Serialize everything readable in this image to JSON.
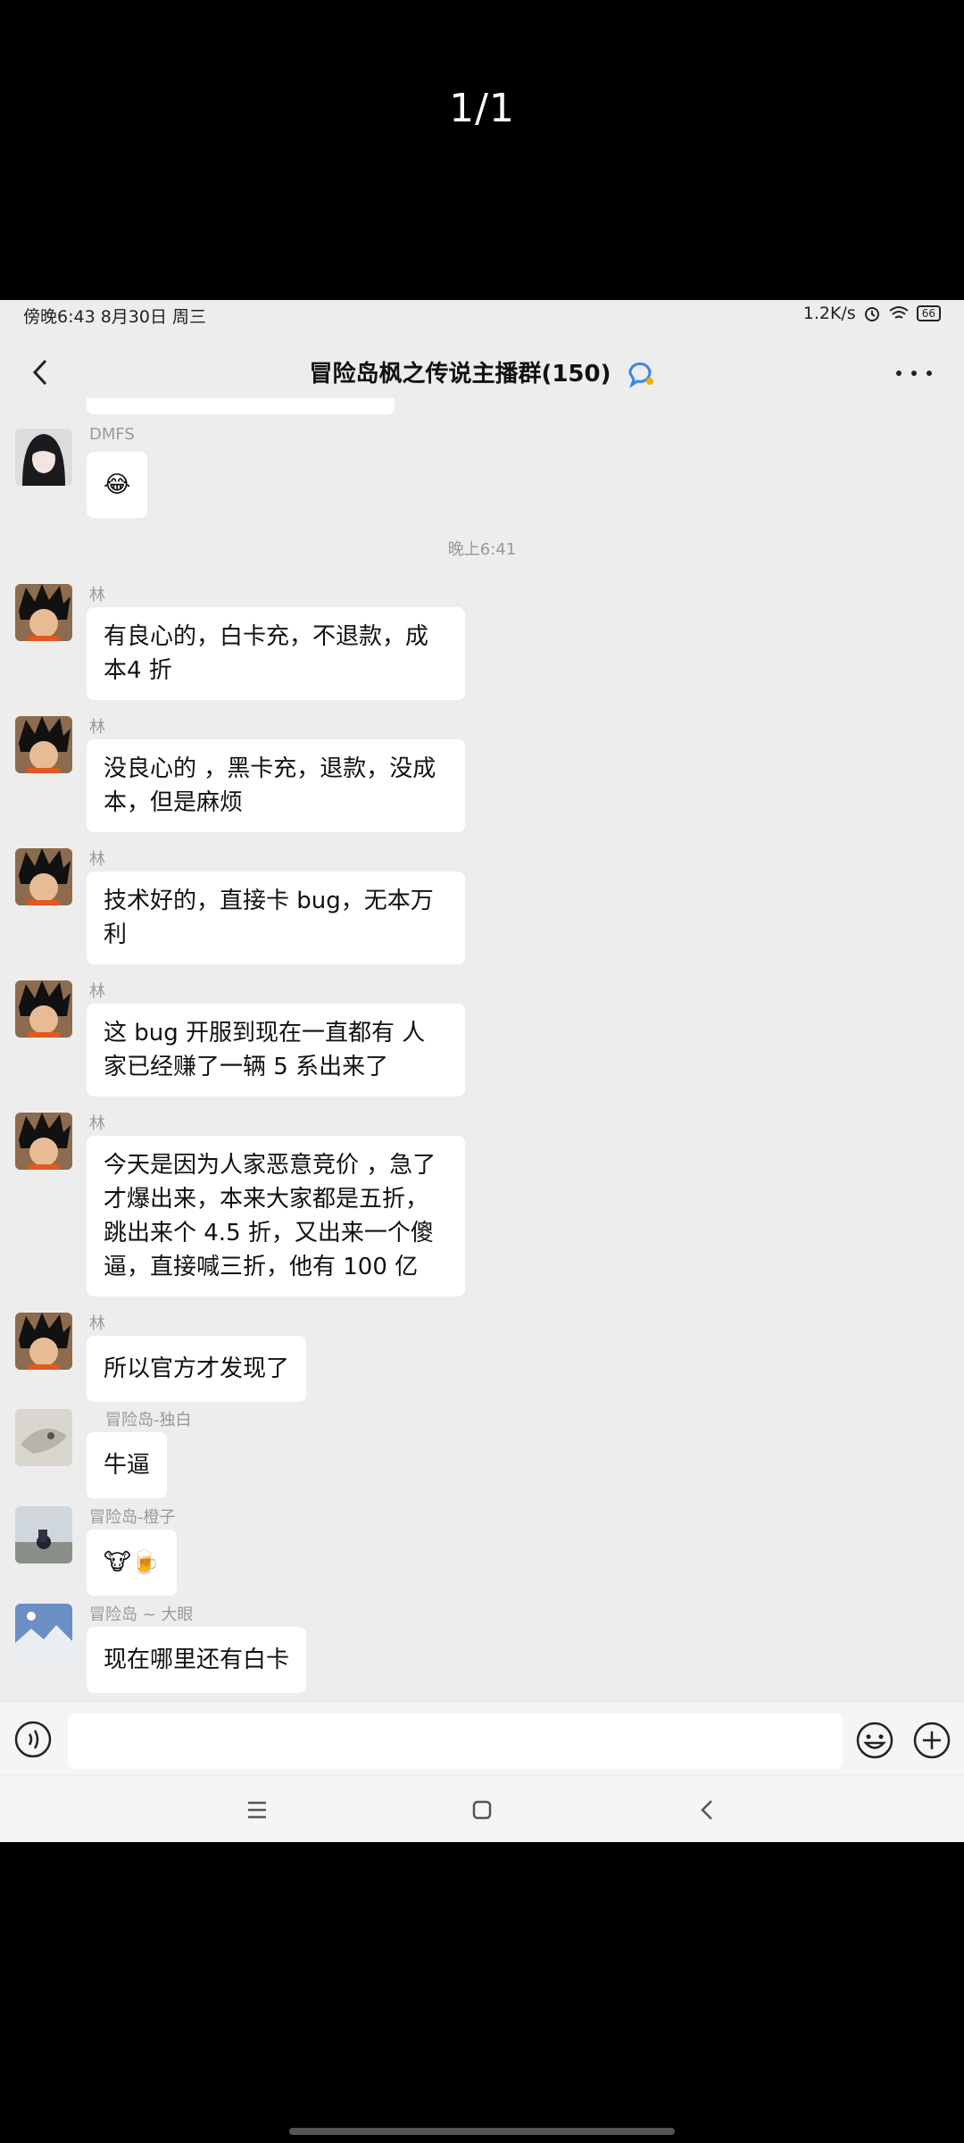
{
  "viewer": {
    "page_counter": "1/1"
  },
  "status_bar": {
    "left_text": "傍晚6:43 8月30日 周三",
    "net_speed": "1.2K/s",
    "battery": "66"
  },
  "header": {
    "title": "冒险岛枫之传说主播群(150)",
    "back_icon": "chevron-left-icon",
    "more_icon": "more-dots-icon"
  },
  "messages": [
    {
      "sender": "DMFS",
      "text": "😂",
      "avatar": "dark-hair-avatar"
    },
    {
      "timestamp": "晚上6:41"
    },
    {
      "sender": "林",
      "text": "有良心的，白卡充，不退款，成本4 折"
    },
    {
      "sender": "林",
      "text": "没良心的 ，黑卡充，退款，没成本，但是麻烦"
    },
    {
      "sender": "林",
      "text": "技术好的，直接卡 bug，无本万利"
    },
    {
      "sender": "林",
      "text": "这 bug 开服到现在一直都有 人家已经赚了一辆 5 系出来了"
    },
    {
      "sender": "林",
      "text": "今天是因为人家恶意竞价 ，急了才爆出来，本来大家都是五折，跳出来个 4.5 折，又出来一个傻逼，直接喊三折，他有 100 亿"
    },
    {
      "sender": "林",
      "text": "所以官方才发现了"
    },
    {
      "sender": "冒险岛-独白",
      "text": "牛逼"
    },
    {
      "sender": "冒险岛-橙子",
      "text": "🐮🍺"
    },
    {
      "sender": "冒险岛 ~ 大眼",
      "text": "现在哪里还有白卡"
    }
  ],
  "input_bar": {
    "voice_icon": "voice-icon",
    "emoji_icon": "emoji-icon",
    "plus_icon": "plus-icon",
    "placeholder": ""
  },
  "system_nav": {
    "menu_icon": "menu-icon",
    "home_icon": "home-icon",
    "back_icon": "back-icon"
  },
  "colors": {
    "chat_bg": "#ededed",
    "bubble_bg": "#ffffff",
    "input_bg": "#f5f5f5"
  }
}
